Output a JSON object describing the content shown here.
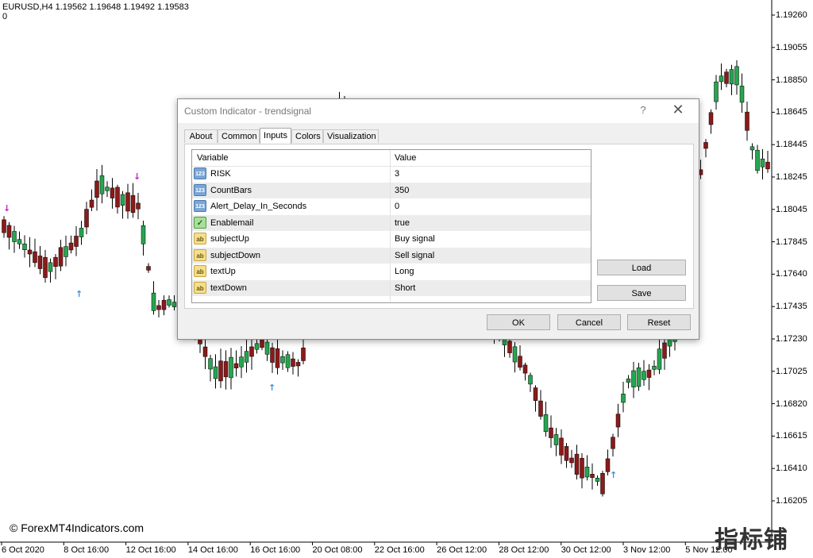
{
  "chart": {
    "symbol_line": "EURUSD,H4  1.19562 1.19648 1.19492 1.19583",
    "sub_line": "0",
    "watermark": "© ForexMT4Indicators.com",
    "brand": "指标铺",
    "price_labels": [
      "1.19260",
      "1.19055",
      "1.18850",
      "1.18645",
      "1.18445",
      "1.18245",
      "1.18045",
      "1.17845",
      "1.17640",
      "1.17435",
      "1.17230",
      "1.17025",
      "1.16820",
      "1.16615",
      "1.16410",
      "1.16205"
    ],
    "time_labels": [
      "6 Oct 2020",
      "8 Oct 16:00",
      "12 Oct 16:00",
      "14 Oct 16:00",
      "16 Oct 16:00",
      "20 Oct 08:00",
      "22 Oct 16:00",
      "26 Oct 12:00",
      "28 Oct 12:00",
      "30 Oct 12:00",
      "3 Nov 12:00",
      "5 Nov 12:00"
    ],
    "colors": {
      "bull": "#26a650",
      "bear": "#8b1a1a",
      "arrow_up": "#3a8fd6",
      "arrow_down": "#c020c0",
      "grid_axis": "#000000"
    }
  },
  "dialog": {
    "title": "Custom Indicator - trendsignal",
    "help": "?",
    "close": "✕",
    "tabs": [
      {
        "label": "About"
      },
      {
        "label": "Common"
      },
      {
        "label": "Inputs",
        "active": true
      },
      {
        "label": "Colors"
      },
      {
        "label": "Visualization"
      }
    ],
    "columns": {
      "variable": "Variable",
      "value": "Value"
    },
    "rows": [
      {
        "icon": "123",
        "variable": "RISK",
        "value": "3"
      },
      {
        "icon": "123",
        "variable": "CountBars",
        "value": "350"
      },
      {
        "icon": "123",
        "variable": "Alert_Delay_In_Seconds",
        "value": "0"
      },
      {
        "icon": "bool",
        "variable": "Enablemail",
        "value": "true"
      },
      {
        "icon": "ab",
        "variable": "subjectUp",
        "value": "Buy signal"
      },
      {
        "icon": "ab",
        "variable": "subjectDown",
        "value": "Sell signal"
      },
      {
        "icon": "ab",
        "variable": "textUp",
        "value": "Long"
      },
      {
        "icon": "ab",
        "variable": "textDown",
        "value": "Short"
      }
    ],
    "buttons": {
      "load": "Load",
      "save": "Save",
      "ok": "OK",
      "cancel": "Cancel",
      "reset": "Reset"
    }
  }
}
